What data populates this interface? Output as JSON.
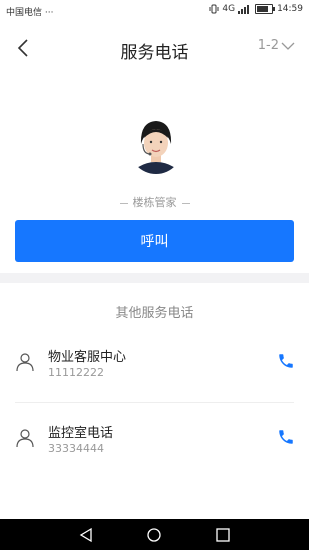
{
  "status_bar": {
    "carrier": "中国电信 ···",
    "time": "14:59",
    "network": "4G"
  },
  "header": {
    "title": "服务电话",
    "page_indicator": "1-2"
  },
  "profile": {
    "role": "楼栋管家"
  },
  "call_button": {
    "label": "呼叫"
  },
  "other_services": {
    "title": "其他服务电话",
    "items": [
      {
        "name": "物业客服中心",
        "number": "11112222"
      },
      {
        "name": "监控室电话",
        "number": "33334444"
      }
    ]
  },
  "colors": {
    "accent": "#1677ff"
  },
  "icons": [
    "back-arrow-icon",
    "chevron-down-icon",
    "person-icon",
    "phone-icon"
  ]
}
